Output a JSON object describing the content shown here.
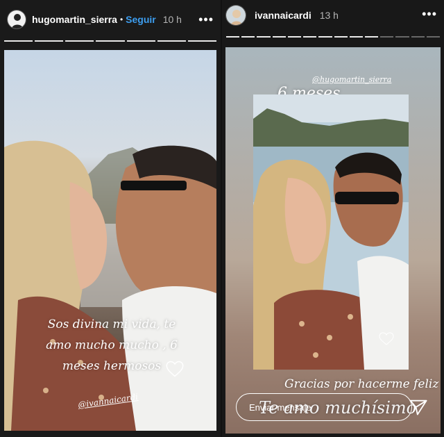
{
  "left_story": {
    "username": "hugomartin_sierra",
    "separator": "•",
    "follow_label": "Seguir",
    "time_ago": "10 h",
    "more_label": "•••",
    "progress_total": 7,
    "progress_done": 7,
    "caption_lines": [
      "Sos divina mi vida, te",
      "amo mucho mucho , 6",
      "meses hermosos"
    ],
    "mention": "@ivannaicardi"
  },
  "right_story": {
    "username": "ivannaicardi",
    "time_ago": "13 h",
    "more_label": "•••",
    "progress_total": 14,
    "progress_done": 10,
    "mention": "@hugomartin_sierra",
    "photo_caption": "6 meses",
    "thanks_text": "Gracias por hacerme feliz",
    "love_text": "Te amo muchísimo",
    "message_placeholder": "Enviar mensaje"
  },
  "colors": {
    "follow_blue": "#3d9ef0",
    "background": "#1a1a1a"
  }
}
